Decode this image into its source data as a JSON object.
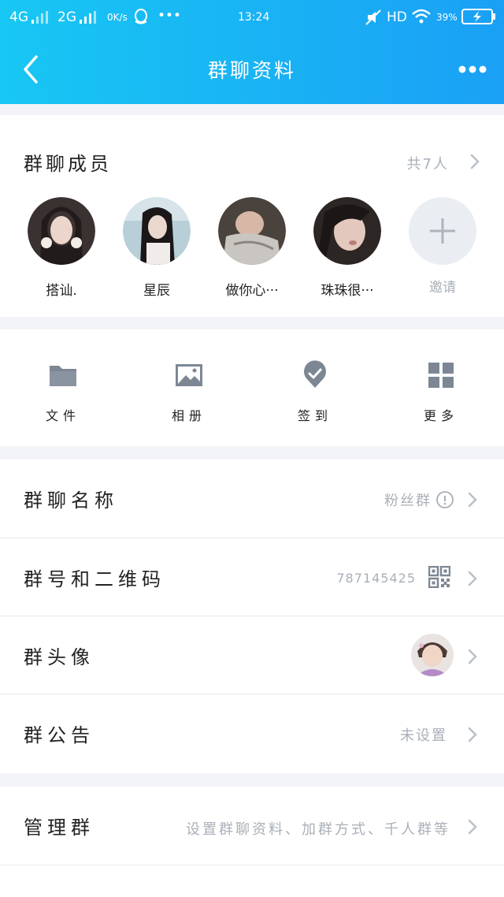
{
  "status_bar": {
    "signal_1": "4G",
    "signal_2": "2G",
    "net_speed": "0K/s",
    "app_icon": "qq-icon",
    "more": "•••",
    "time": "13:24",
    "hd": "HD",
    "battery": "39%"
  },
  "header": {
    "title": "群聊资料",
    "back_icon": "back-arrow-icon",
    "more_icon": "more-dots-icon"
  },
  "members": {
    "title": "群聊成员",
    "count": "共7人",
    "list": [
      {
        "name": "搭讪."
      },
      {
        "name": "星辰"
      },
      {
        "name": "做你心···"
      },
      {
        "name": "珠珠很···"
      }
    ],
    "invite_label": "邀请"
  },
  "tools": [
    {
      "label": "文件",
      "icon": "folder-icon"
    },
    {
      "label": "相册",
      "icon": "image-icon"
    },
    {
      "label": "签到",
      "icon": "checkin-icon"
    },
    {
      "label": "更多",
      "icon": "grid-icon"
    }
  ],
  "settings": {
    "group_name_label": "群聊名称",
    "group_name_value": "粉丝群",
    "group_id_label": "群号和二维码",
    "group_id_value": "787145425",
    "group_avatar_label": "群头像",
    "notice_label": "群公告",
    "notice_value": "未设置",
    "manage_label": "管理群",
    "manage_hint": "设置群聊资料、加群方式、千人群等"
  },
  "colors": {
    "header_start": "#18c7f3",
    "header_end": "#1aa0f5",
    "icon_gray": "#7d8794",
    "hint_gray": "#a9b0b8"
  }
}
